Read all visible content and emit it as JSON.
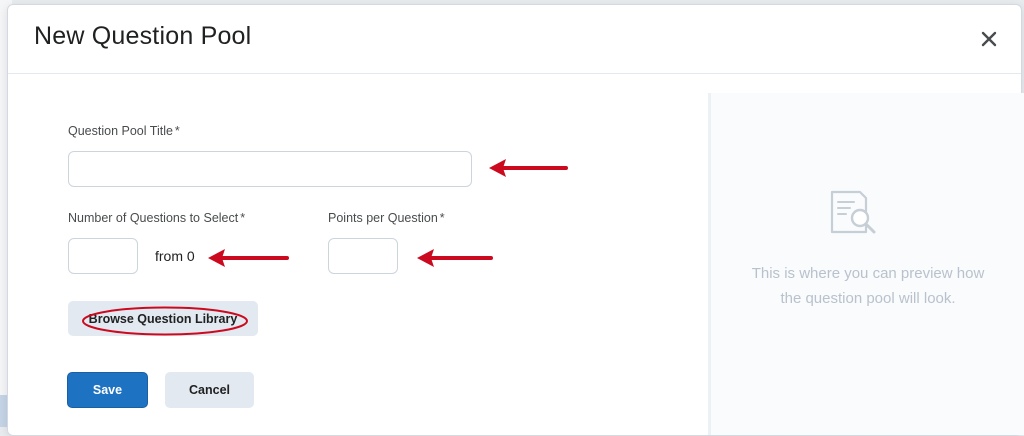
{
  "dialog": {
    "title": "New Question Pool"
  },
  "form": {
    "title_field": {
      "label": "Question Pool Title",
      "value": "",
      "placeholder": ""
    },
    "num_questions_field": {
      "label": "Number of Questions to Select",
      "value": "",
      "from_text": "from 0"
    },
    "points_field": {
      "label": "Points per Question",
      "value": ""
    },
    "required_marker": "*",
    "browse_label": "Browse Question Library",
    "save_label": "Save",
    "cancel_label": "Cancel"
  },
  "preview": {
    "icon": "document-search-icon",
    "message": "This is where you can preview how the question pool will look."
  },
  "colors": {
    "primary": "#1e72c2",
    "annotation": "#cc0a1f",
    "muted": "#b9c2cc"
  }
}
